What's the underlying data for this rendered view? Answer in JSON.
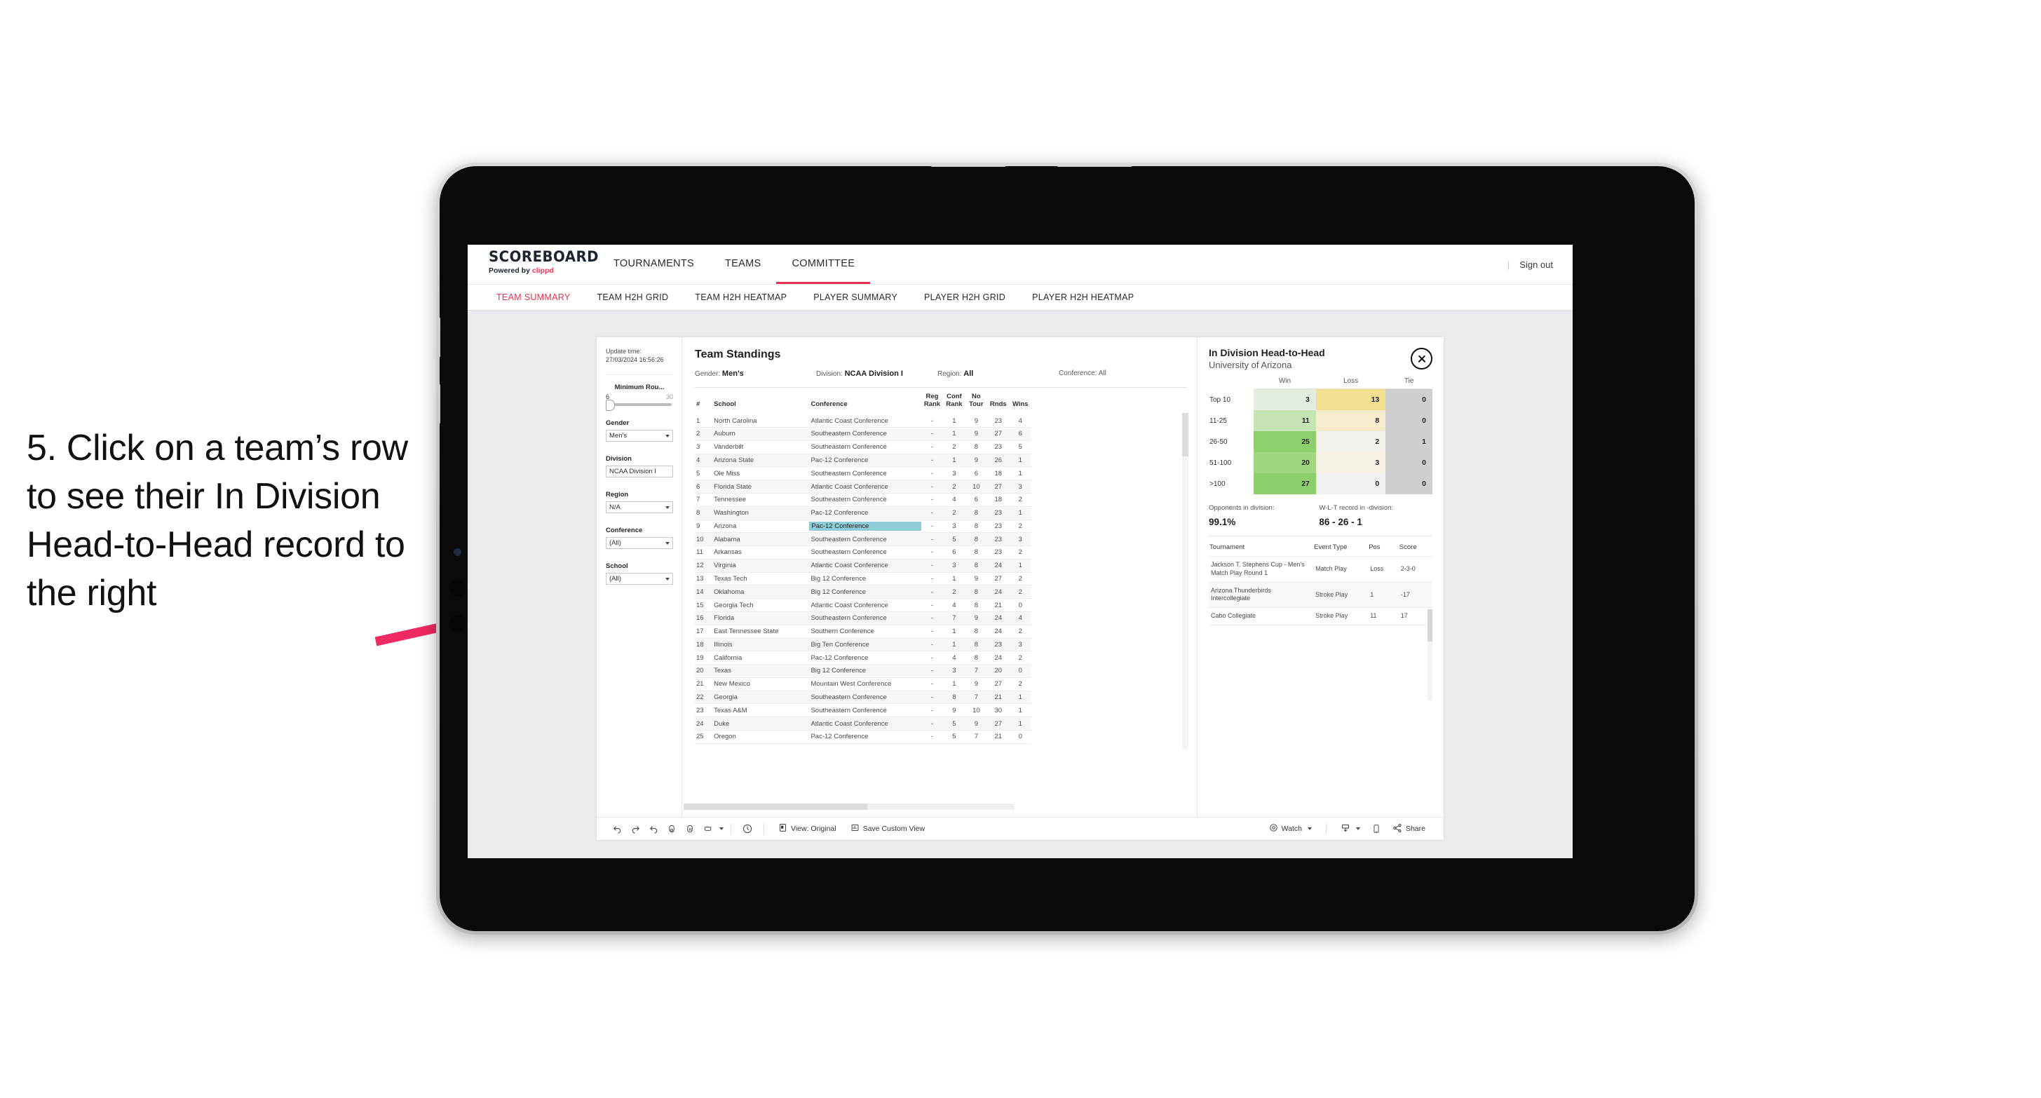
{
  "annotation": {
    "text": "5. Click on a team’s row to see their In Division Head-to-Head record to the right",
    "arrow_color": "#ef2a62"
  },
  "app": {
    "logo_main": "SCOREBOARD",
    "logo_sub_prefix": "Powered by ",
    "logo_brand": "clippd",
    "nav": [
      {
        "label": "TOURNAMENTS",
        "active": false
      },
      {
        "label": "TEAMS",
        "active": false
      },
      {
        "label": "COMMITTEE",
        "active": true
      }
    ],
    "signout": "Sign out",
    "subtabs": [
      {
        "label": "TEAM SUMMARY",
        "active": true
      },
      {
        "label": "TEAM H2H GRID",
        "active": false
      },
      {
        "label": "TEAM H2H HEATMAP",
        "active": false
      },
      {
        "label": "PLAYER SUMMARY",
        "active": false
      },
      {
        "label": "PLAYER H2H GRID",
        "active": false
      },
      {
        "label": "PLAYER H2H HEATMAP",
        "active": false
      }
    ]
  },
  "filters": {
    "update_label": "Update time:",
    "update_value": "27/03/2024 16:56:26",
    "slider": {
      "title": "Minimum Rou...",
      "min": "6",
      "max": "30"
    },
    "gender": {
      "label": "Gender",
      "value": "Men’s"
    },
    "division": {
      "label": "Division",
      "value": "NCAA Division I"
    },
    "region": {
      "label": "Region",
      "value": "N/A"
    },
    "conference": {
      "label": "Conference",
      "value": "(All)"
    },
    "school": {
      "label": "School",
      "value": "(All)"
    }
  },
  "standings": {
    "title": "Team Standings",
    "meta": [
      {
        "label": "Gender: ",
        "value": "Men’s"
      },
      {
        "label": "Division: ",
        "value": "NCAA Division I"
      },
      {
        "label": "Region: ",
        "value": "All"
      },
      {
        "label": "Conference: ",
        "value": "All"
      }
    ],
    "columns": [
      "#",
      "School",
      "Conference",
      "Reg Rank",
      "Conf Rank",
      "No Tour",
      "Rnds",
      "Wins"
    ],
    "rows": [
      {
        "rank": "1",
        "school": "North Carolina",
        "conf": "Atlantic Coast Conference",
        "reg": "-",
        "crank": "1",
        "notour": "9",
        "rnds": "23",
        "wins": "4",
        "hl": false
      },
      {
        "rank": "2",
        "school": "Auburn",
        "conf": "Southeastern Conference",
        "reg": "-",
        "crank": "1",
        "notour": "9",
        "rnds": "27",
        "wins": "6",
        "hl": false
      },
      {
        "rank": "3",
        "school": "Vanderbilt",
        "conf": "Southeastern Conference",
        "reg": "-",
        "crank": "2",
        "notour": "8",
        "rnds": "23",
        "wins": "5",
        "hl": false
      },
      {
        "rank": "4",
        "school": "Arizona State",
        "conf": "Pac-12 Conference",
        "reg": "-",
        "crank": "1",
        "notour": "9",
        "rnds": "26",
        "wins": "1",
        "hl": false
      },
      {
        "rank": "5",
        "school": "Ole Miss",
        "conf": "Southeastern Conference",
        "reg": "-",
        "crank": "3",
        "notour": "6",
        "rnds": "18",
        "wins": "1",
        "hl": false
      },
      {
        "rank": "6",
        "school": "Florida State",
        "conf": "Atlantic Coast Conference",
        "reg": "-",
        "crank": "2",
        "notour": "10",
        "rnds": "27",
        "wins": "3",
        "hl": false
      },
      {
        "rank": "7",
        "school": "Tennessee",
        "conf": "Southeastern Conference",
        "reg": "-",
        "crank": "4",
        "notour": "6",
        "rnds": "18",
        "wins": "2",
        "hl": false
      },
      {
        "rank": "8",
        "school": "Washington",
        "conf": "Pac-12 Conference",
        "reg": "-",
        "crank": "2",
        "notour": "8",
        "rnds": "23",
        "wins": "1",
        "hl": false
      },
      {
        "rank": "9",
        "school": "Arizona",
        "conf": "Pac-12 Conference",
        "reg": "-",
        "crank": "3",
        "notour": "8",
        "rnds": "23",
        "wins": "2",
        "hl": true
      },
      {
        "rank": "10",
        "school": "Alabama",
        "conf": "Southeastern Conference",
        "reg": "-",
        "crank": "5",
        "notour": "8",
        "rnds": "23",
        "wins": "3",
        "hl": false
      },
      {
        "rank": "11",
        "school": "Arkansas",
        "conf": "Southeastern Conference",
        "reg": "-",
        "crank": "6",
        "notour": "8",
        "rnds": "23",
        "wins": "2",
        "hl": false
      },
      {
        "rank": "12",
        "school": "Virginia",
        "conf": "Atlantic Coast Conference",
        "reg": "-",
        "crank": "3",
        "notour": "8",
        "rnds": "24",
        "wins": "1",
        "hl": false
      },
      {
        "rank": "13",
        "school": "Texas Tech",
        "conf": "Big 12 Conference",
        "reg": "-",
        "crank": "1",
        "notour": "9",
        "rnds": "27",
        "wins": "2",
        "hl": false
      },
      {
        "rank": "14",
        "school": "Oklahoma",
        "conf": "Big 12 Conference",
        "reg": "-",
        "crank": "2",
        "notour": "8",
        "rnds": "24",
        "wins": "2",
        "hl": false
      },
      {
        "rank": "15",
        "school": "Georgia Tech",
        "conf": "Atlantic Coast Conference",
        "reg": "-",
        "crank": "4",
        "notour": "8",
        "rnds": "21",
        "wins": "0",
        "hl": false
      },
      {
        "rank": "16",
        "school": "Florida",
        "conf": "Southeastern Conference",
        "reg": "-",
        "crank": "7",
        "notour": "9",
        "rnds": "24",
        "wins": "4",
        "hl": false
      },
      {
        "rank": "17",
        "school": "East Tennessee State",
        "conf": "Southern Conference",
        "reg": "-",
        "crank": "1",
        "notour": "8",
        "rnds": "24",
        "wins": "2",
        "hl": false
      },
      {
        "rank": "18",
        "school": "Illinois",
        "conf": "Big Ten Conference",
        "reg": "-",
        "crank": "1",
        "notour": "8",
        "rnds": "23",
        "wins": "3",
        "hl": false
      },
      {
        "rank": "19",
        "school": "California",
        "conf": "Pac-12 Conference",
        "reg": "-",
        "crank": "4",
        "notour": "8",
        "rnds": "24",
        "wins": "2",
        "hl": false
      },
      {
        "rank": "20",
        "school": "Texas",
        "conf": "Big 12 Conference",
        "reg": "-",
        "crank": "3",
        "notour": "7",
        "rnds": "20",
        "wins": "0",
        "hl": false
      },
      {
        "rank": "21",
        "school": "New Mexico",
        "conf": "Mountain West Conference",
        "reg": "-",
        "crank": "1",
        "notour": "9",
        "rnds": "27",
        "wins": "2",
        "hl": false
      },
      {
        "rank": "22",
        "school": "Georgia",
        "conf": "Southeastern Conference",
        "reg": "-",
        "crank": "8",
        "notour": "7",
        "rnds": "21",
        "wins": "1",
        "hl": false
      },
      {
        "rank": "23",
        "school": "Texas A&M",
        "conf": "Southeastern Conference",
        "reg": "-",
        "crank": "9",
        "notour": "10",
        "rnds": "30",
        "wins": "1",
        "hl": false
      },
      {
        "rank": "24",
        "school": "Duke",
        "conf": "Atlantic Coast Conference",
        "reg": "-",
        "crank": "5",
        "notour": "9",
        "rnds": "27",
        "wins": "1",
        "hl": false
      },
      {
        "rank": "25",
        "school": "Oregon",
        "conf": "Pac-12 Conference",
        "reg": "-",
        "crank": "5",
        "notour": "7",
        "rnds": "21",
        "wins": "0",
        "hl": false
      }
    ]
  },
  "h2h": {
    "title": "In Division Head-to-Head",
    "subtitle": "University of Arizona",
    "close_icon": "close-circle-icon",
    "columns": [
      "",
      "Win",
      "Loss",
      "Tie"
    ],
    "rows": [
      {
        "label": "Top 10",
        "win": "3",
        "loss": "13",
        "tie": "0",
        "win_color": "#e4eede",
        "loss_color": "#f2df90",
        "tie_color": "#cfcfcf"
      },
      {
        "label": "11-25",
        "win": "11",
        "loss": "8",
        "tie": "0",
        "win_color": "#c6e3b4",
        "loss_color": "#f5ecce",
        "tie_color": "#cfcfcf"
      },
      {
        "label": "26-50",
        "win": "25",
        "loss": "2",
        "tie": "1",
        "win_color": "#8fd06e",
        "loss_color": "#f2f1ec",
        "tie_color": "#cfcfcf"
      },
      {
        "label": "51-100",
        "win": "20",
        "loss": "3",
        "tie": "0",
        "win_color": "#9fd67f",
        "loss_color": "#f4f0e4",
        "tie_color": "#cfcfcf"
      },
      {
        "label": ">100",
        "win": "27",
        "loss": "0",
        "tie": "0",
        "win_color": "#8ccf6b",
        "loss_color": "#f1f1f1",
        "tie_color": "#cfcfcf"
      }
    ],
    "stats": [
      {
        "label": "Opponents in division:",
        "value": "99.1%"
      },
      {
        "label": "W-L-T record in -division:",
        "value": "86 - 26 - 1"
      }
    ],
    "tournament_columns": [
      "Tournament",
      "Event Type",
      "Pos",
      "Score"
    ],
    "tournaments": [
      {
        "name": "Jackson T. Stephens Cup - Men’s Match Play Round 1",
        "type": "Match Play",
        "pos": "Loss",
        "score": "2-3-0"
      },
      {
        "name": "Arizona Thunderbirds Intercollegiate",
        "type": "Stroke Play",
        "pos": "1",
        "score": "-17"
      },
      {
        "name": "Cabo Collegiate",
        "type": "Stroke Play",
        "pos": "11",
        "score": "17"
      }
    ]
  },
  "toolbar": {
    "icons": [
      "undo-icon",
      "redo-icon",
      "revert-icon",
      "refresh-data-icon",
      "pause-icon",
      "layout-icon"
    ],
    "clock_icon": "clock-icon",
    "view_label": "View: Original",
    "view_icon": "view-icon",
    "save_label": "Save Custom View",
    "save_icon": "save-view-icon",
    "watch_label": "Watch",
    "watch_icon": "watch-icon",
    "download_icon": "download-icon",
    "device_icon": "device-icon",
    "share_label": "Share",
    "share_icon": "share-icon"
  }
}
